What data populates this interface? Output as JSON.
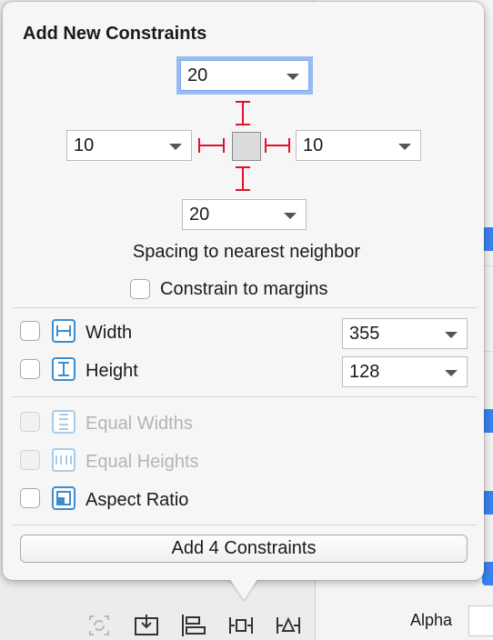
{
  "popover": {
    "title": "Add New Constraints",
    "spacing": {
      "top": "20",
      "left": "10",
      "right": "10",
      "bottom": "20"
    },
    "spacing_label": "Spacing to nearest neighbor",
    "constrain_to_margins_label": "Constrain to margins",
    "size": {
      "width_label": "Width",
      "width_value": "355",
      "height_label": "Height",
      "height_value": "128"
    },
    "relations": {
      "equal_widths_label": "Equal Widths",
      "equal_heights_label": "Equal Heights",
      "aspect_ratio_label": "Aspect Ratio"
    },
    "add_button_label": "Add 4 Constraints"
  },
  "inspector": {
    "alpha_label": "Alpha"
  },
  "colors": {
    "strut": "#e2102a",
    "focus_ring": "#97bdf3",
    "icon_blue": "#3c8dd0",
    "accent_blue": "#3b82f0"
  },
  "icons": [
    "update-frames-icon",
    "embed-in-stack-icon",
    "align-icon",
    "pin-icon",
    "resolve-issues-icon"
  ]
}
